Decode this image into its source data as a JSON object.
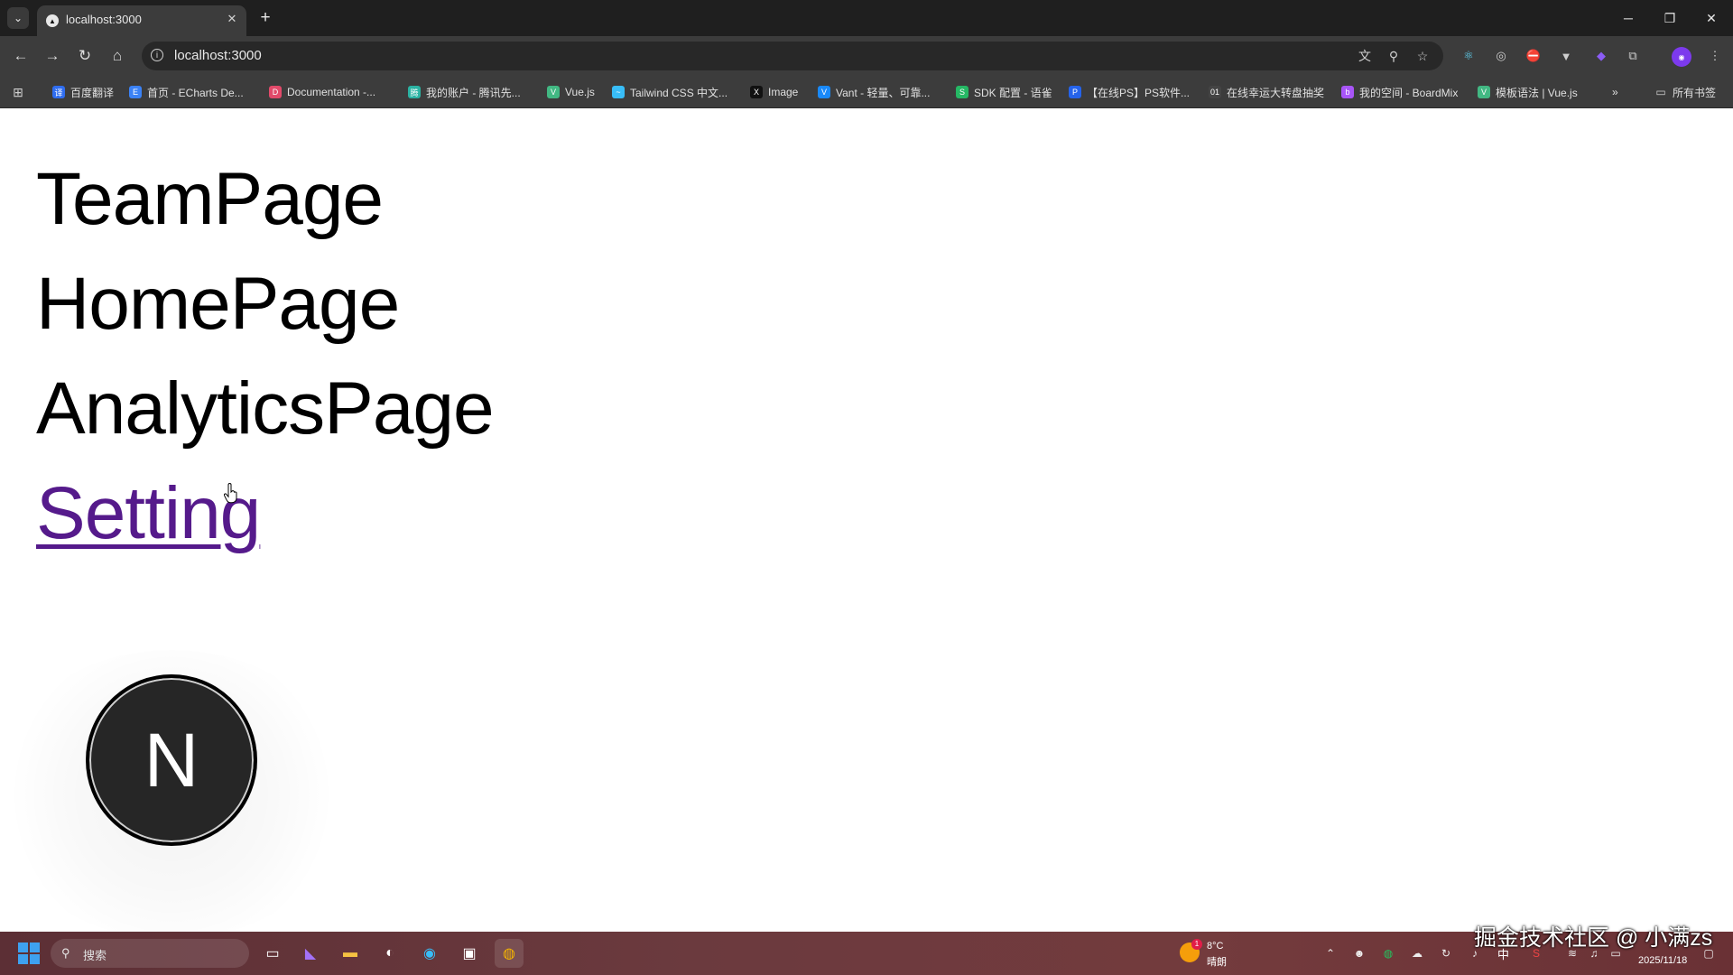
{
  "browser": {
    "tab": {
      "title": "localhost:3000",
      "close": "✕"
    },
    "new_tab": "+",
    "window": {
      "minimize": "─",
      "restore": "❐",
      "close": "✕"
    },
    "address": "localhost:3000",
    "nav": {
      "back": "←",
      "forward": "→",
      "reload": "↻",
      "home": "⌂"
    },
    "bookmarks": [
      {
        "label": "百度翻译",
        "color": "#2f6df0",
        "glyph": "译"
      },
      {
        "label": "首页 - ECharts De...",
        "color": "#3b82f6",
        "glyph": "E"
      },
      {
        "label": "Documentation -...",
        "color": "#e24a6a",
        "glyph": "D"
      },
      {
        "label": "我的账户 - 腾讯先...",
        "color": "#2bb3a3",
        "glyph": "腾"
      },
      {
        "label": "Vue.js",
        "color": "#42b883",
        "glyph": "V"
      },
      {
        "label": "Tailwind CSS 中文...",
        "color": "#38bdf8",
        "glyph": "~"
      },
      {
        "label": "Image",
        "color": "#111111",
        "glyph": "X"
      },
      {
        "label": "Vant - 轻量、可靠...",
        "color": "#1989fa",
        "glyph": "V"
      },
      {
        "label": "SDK 配置 - 语雀",
        "color": "#25b864",
        "glyph": "S"
      },
      {
        "label": "【在线PS】PS软件...",
        "color": "#2563eb",
        "glyph": "P"
      },
      {
        "label": "在线幸运大转盘抽奖",
        "color": "#444444",
        "glyph": "01"
      },
      {
        "label": "我的空间 - BoardMix",
        "color": "#a855f7",
        "glyph": "b"
      },
      {
        "label": "模板语法 | Vue.js",
        "color": "#42b883",
        "glyph": "V"
      }
    ],
    "bookmarks_overflow": "»",
    "all_bookmarks": "所有书签"
  },
  "page": {
    "links": {
      "team": "TeamPage",
      "home": "HomePage",
      "analytics": "AnalyticsPage",
      "setting": "Setting"
    },
    "logo_letter": "N"
  },
  "taskbar": {
    "search_placeholder": "搜索",
    "weather_temp": "8°C",
    "weather_desc": "晴朗",
    "weather_badge": "1",
    "ime": "中",
    "date": "2025/11/18",
    "watermark": "掘金技术社区 @ 小满zs"
  }
}
